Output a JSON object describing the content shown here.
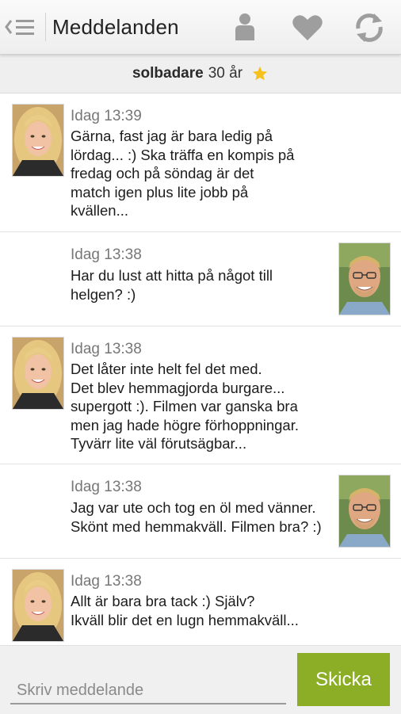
{
  "app": {
    "title": "Meddelanden"
  },
  "actionbar": {
    "up_icon": "back-list-icon",
    "actions": [
      "profile-icon",
      "heart-icon",
      "refresh-icon"
    ]
  },
  "profile": {
    "name": "solbadare",
    "age": "30 år",
    "star": "star-icon",
    "star_color": "#f5c21b"
  },
  "messages": [
    {
      "sender": "her",
      "time": "Idag 13:39",
      "text": "Gärna, fast jag är bara ledig på\nlördag... :) Ska träffa en kompis på\nfredag och på söndag är det\nmatch igen plus lite jobb på\nkvällen..."
    },
    {
      "sender": "me",
      "time": "Idag 13:38",
      "text": "Har du lust att hitta på något till\nhelgen?  :)"
    },
    {
      "sender": "her",
      "time": "Idag 13:38",
      "text": "Det låter inte helt fel det med.\nDet blev hemmagjorda burgare...\nsupergott :). Filmen var ganska bra\nmen jag hade högre förhoppningar.\nTyvärr lite väl förutsägbar..."
    },
    {
      "sender": "me",
      "time": "Idag 13:38",
      "text": "Jag var ute och tog en öl med vänner.\nSkönt med hemmakväll. Filmen bra? :)"
    },
    {
      "sender": "her",
      "time": "Idag 13:38",
      "text": "Allt är bara bra tack :) Själv?\nIkväll blir det en lugn hemmakväll..."
    }
  ],
  "compose": {
    "placeholder": "Skriv meddelande",
    "value": "",
    "send_label": "Skicka",
    "send_color": "#8cae26"
  }
}
